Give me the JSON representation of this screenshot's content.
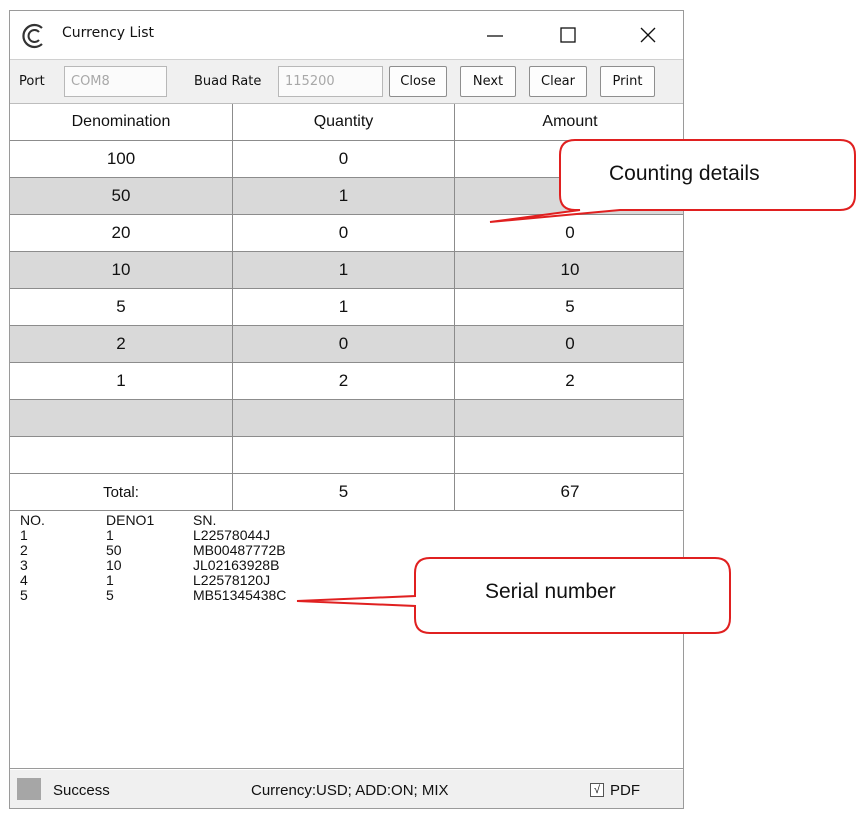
{
  "window": {
    "title": "Currency List",
    "logo_icon": "currency-c-logo",
    "controls": [
      "minimize-icon",
      "maximize-icon",
      "close-icon"
    ]
  },
  "toolbar": {
    "port_label": "Port",
    "port_value": "COM8",
    "baud_label": "Buad Rate",
    "baud_value": "115200",
    "close_label": "Close",
    "next_label": "Next",
    "clear_label": "Clear",
    "print_label": "Print"
  },
  "table": {
    "headers": [
      "Denomination",
      "Quantity",
      "Amount"
    ],
    "rows": [
      {
        "denomination": "100",
        "quantity": "0",
        "amount": ""
      },
      {
        "denomination": "50",
        "quantity": "1",
        "amount": ""
      },
      {
        "denomination": "20",
        "quantity": "0",
        "amount": "0"
      },
      {
        "denomination": "10",
        "quantity": "1",
        "amount": "10"
      },
      {
        "denomination": "5",
        "quantity": "1",
        "amount": "5"
      },
      {
        "denomination": "2",
        "quantity": "0",
        "amount": "0"
      },
      {
        "denomination": "1",
        "quantity": "2",
        "amount": "2"
      },
      {
        "denomination": "",
        "quantity": "",
        "amount": ""
      },
      {
        "denomination": "",
        "quantity": "",
        "amount": ""
      }
    ],
    "total": {
      "label": "Total:",
      "quantity": "5",
      "amount": "67"
    }
  },
  "serial_list": {
    "headers": [
      "NO.",
      "DENO1",
      "SN."
    ],
    "rows": [
      {
        "no": "1",
        "deno": "1",
        "sn": "L22578044J"
      },
      {
        "no": "2",
        "deno": "50",
        "sn": "MB00487772B"
      },
      {
        "no": "3",
        "deno": "10",
        "sn": "JL02163928B"
      },
      {
        "no": "4",
        "deno": "1",
        "sn": "L22578120J"
      },
      {
        "no": "5",
        "deno": "5",
        "sn": "MB51345438C"
      }
    ]
  },
  "status": {
    "text": "Success",
    "info": "Currency:USD;   ADD:ON;  MIX",
    "pdf_checked": true,
    "pdf_mark": "√",
    "pdf_label": "PDF"
  },
  "callouts": {
    "counting": "Counting details",
    "serial": "Serial number",
    "color": "#e02020"
  }
}
